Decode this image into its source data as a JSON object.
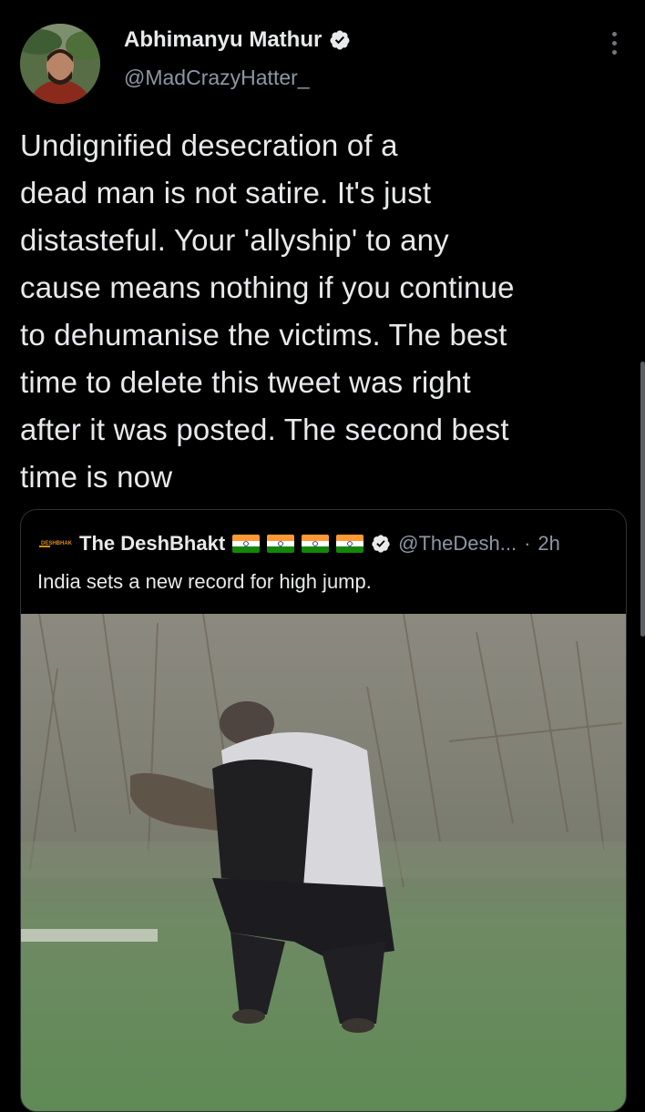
{
  "tweet": {
    "display_name": "Abhimanyu Mathur",
    "handle": "@MadCrazyHatter_",
    "text_lines": [
      "Undignified desecration of a",
      "dead man is not satire. It's just",
      "distasteful. Your 'allyship' to any",
      "cause means nothing if you continue",
      "to dehumanise the victims. The best",
      "time to delete this tweet was right",
      "after it was posted. The second best",
      "time is now"
    ],
    "verified_icon": "verified-badge-icon",
    "more_icon": "more-vertical-icon"
  },
  "quote": {
    "logo_text": "DESHBHAKT",
    "display_name": "The DeshBhakt",
    "flag_icons": [
      "india-flag-icon",
      "india-flag-icon",
      "india-flag-icon",
      "india-flag-icon"
    ],
    "handle": "@TheDesh...",
    "separator": "·",
    "time": "2h",
    "text": "India sets a new record for high jump."
  },
  "colors": {
    "background": "#000000",
    "text": "#e7e9ea",
    "secondary": "#8b98a5",
    "border": "#2f3336"
  }
}
